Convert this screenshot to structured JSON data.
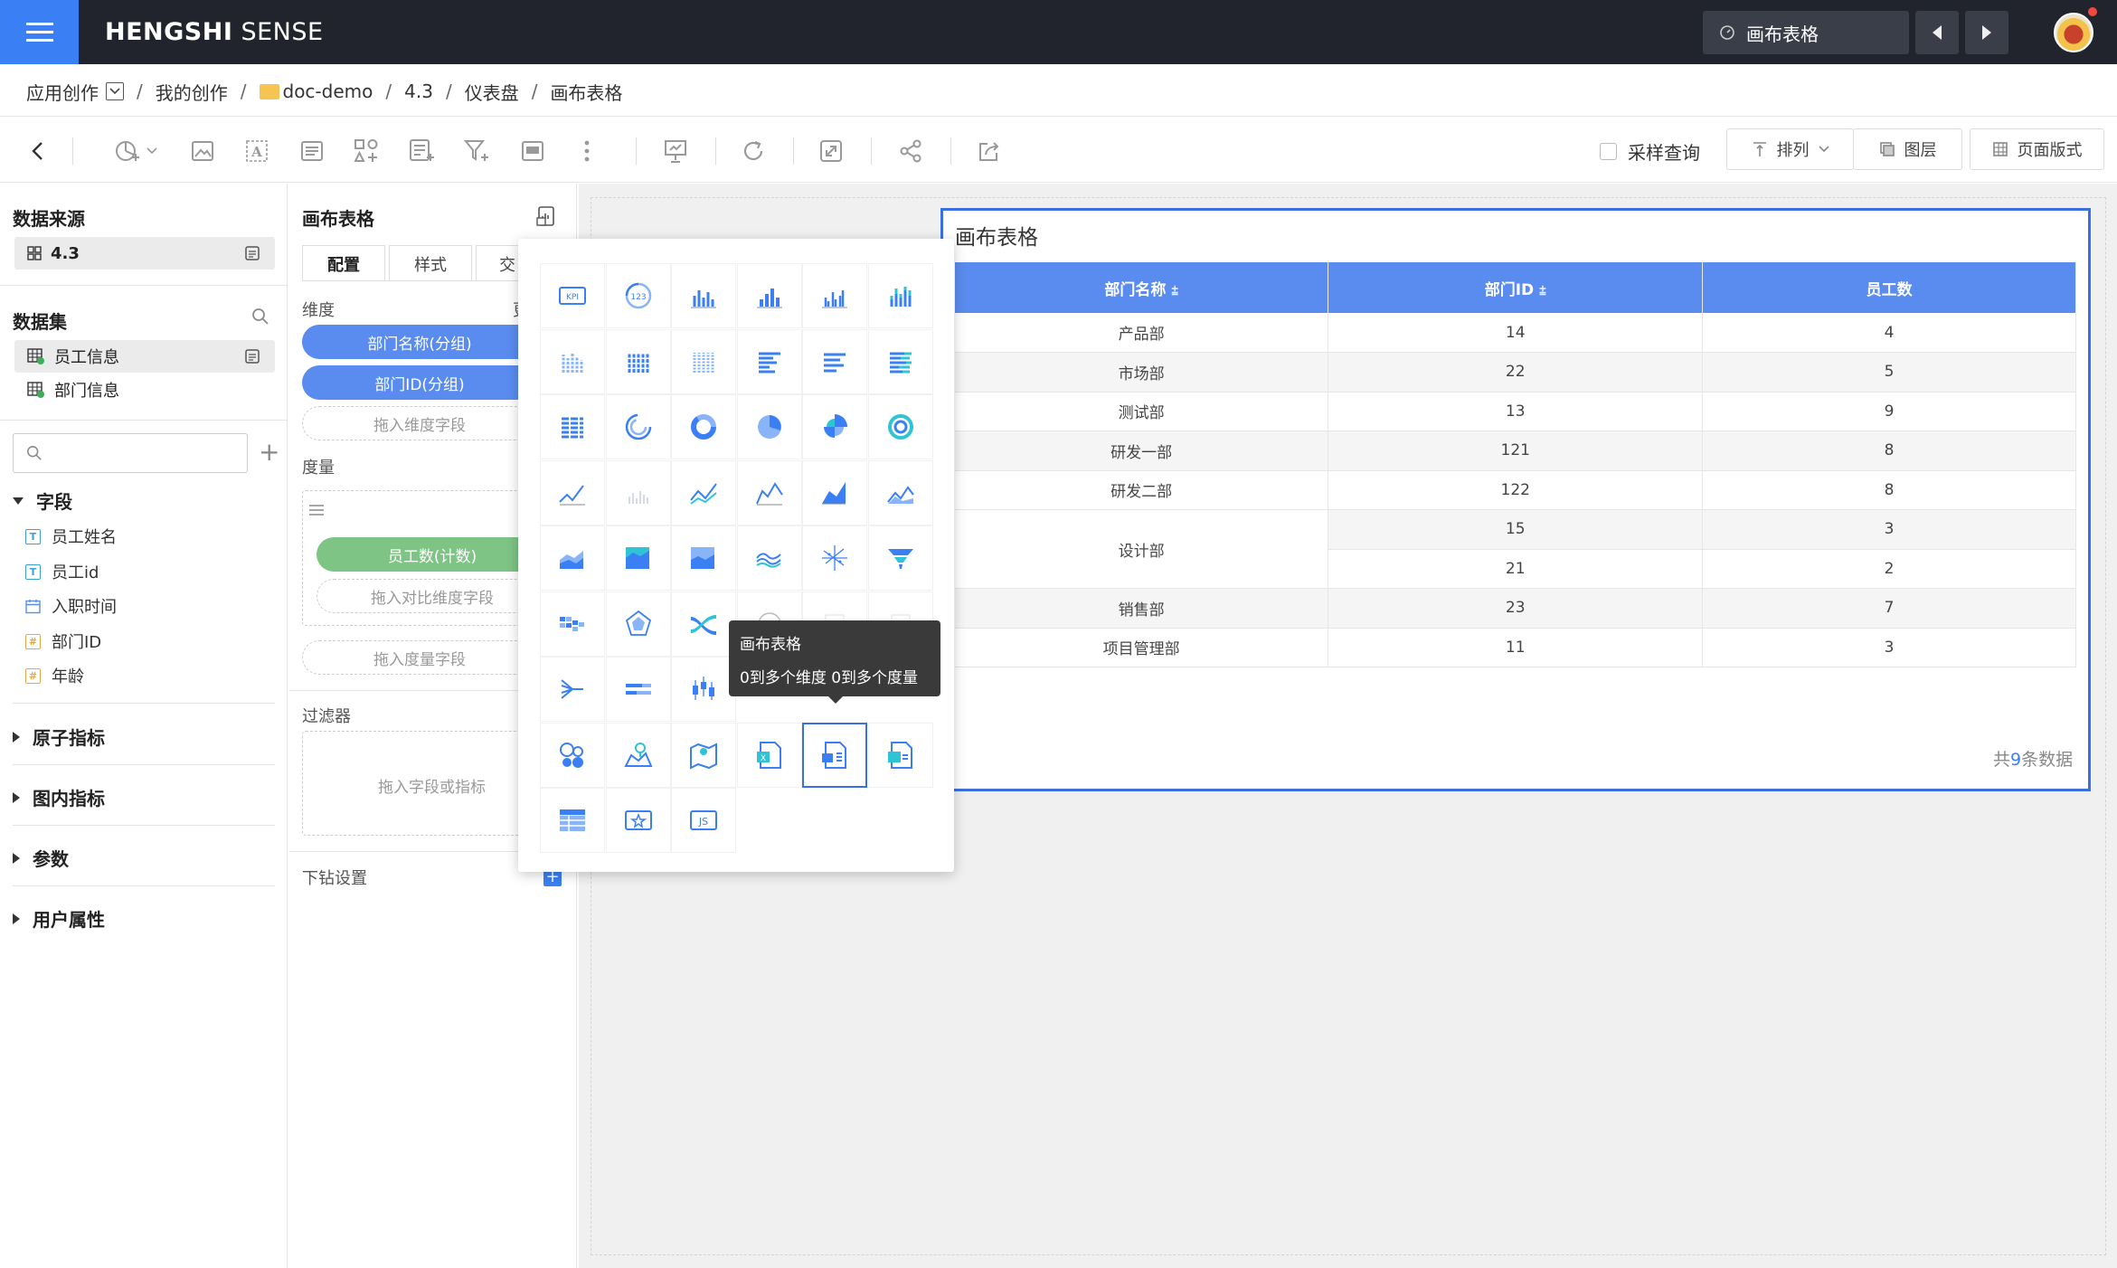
{
  "app": {
    "brand_bold": "HENGSHI",
    "brand_light": " SENSE",
    "current_page": "画布表格"
  },
  "breadcrumb": [
    "应用创作",
    "我的创作",
    "doc-demo",
    "4.3",
    "仪表盘",
    "画布表格"
  ],
  "toolbar": {
    "sample_label": "采样查询",
    "sort_label": "排列",
    "layer_label": "图层",
    "layout_label": "页面版式"
  },
  "left": {
    "datasource_title": "数据来源",
    "datasource_item": "4.3",
    "dataset_title": "数据集",
    "datasets": [
      "员工信息",
      "部门信息"
    ],
    "fields_title": "字段",
    "fields": [
      {
        "label": "员工姓名",
        "type": "T"
      },
      {
        "label": "员工id",
        "type": "T"
      },
      {
        "label": "入职时间",
        "type": "D"
      },
      {
        "label": "部门ID",
        "type": "#"
      },
      {
        "label": "年龄",
        "type": "#"
      }
    ],
    "groups": [
      "原子指标",
      "图内指标",
      "参数",
      "用户属性"
    ]
  },
  "config": {
    "title": "画布表格",
    "tabs": [
      "配置",
      "样式",
      "交"
    ],
    "dimension_label": "维度",
    "dimension_right": "更",
    "dimensions": [
      "部门名称(分组)",
      "部门ID(分组)"
    ],
    "dimension_drop": "拖入维度字段",
    "measure_label": "度量",
    "measure": "员工数(计数)",
    "compare_drop": "拖入对比维度字段",
    "measure_drop": "拖入度量字段",
    "filter_label": "过滤器",
    "filter_drop": "拖入字段或指标",
    "drill_label": "下钻设置"
  },
  "card": {
    "title": "画布表格",
    "headers": [
      "部门名称",
      "部门ID",
      "员工数"
    ],
    "rows": [
      {
        "dept": "产品部",
        "id": "14",
        "count": "4"
      },
      {
        "dept": "市场部",
        "id": "22",
        "count": "5"
      },
      {
        "dept": "测试部",
        "id": "13",
        "count": "9"
      },
      {
        "dept": "研发一部",
        "id": "121",
        "count": "8"
      },
      {
        "dept": "研发二部",
        "id": "122",
        "count": "8"
      },
      {
        "dept": "设计部",
        "id": "15",
        "count": "3"
      },
      {
        "dept": "",
        "id": "21",
        "count": "2"
      },
      {
        "dept": "销售部",
        "id": "23",
        "count": "7"
      },
      {
        "dept": "项目管理部",
        "id": "11",
        "count": "3"
      }
    ],
    "total_prefix": "共",
    "total_count": "9",
    "total_suffix": "条数据"
  },
  "tooltip": {
    "title": "画布表格",
    "desc": "0到多个维度  0到多个度量"
  },
  "picker": {
    "icons": [
      "kpi-icon",
      "gauge-icon",
      "column-icon",
      "grouped-column-icon",
      "multi-column-icon",
      "stacked-column-icon",
      "stacked-column-2-icon",
      "percent-column-icon",
      "grouped-stack-icon",
      "bar-icon",
      "grouped-bar-icon",
      "stacked-bar-icon",
      "percent-bar-icon",
      "radial-bar-icon",
      "donut-icon",
      "pie-icon",
      "rose-icon",
      "ring-icon",
      "line-icon",
      "sparkline-icon",
      "multi-line-icon",
      "area-line-icon",
      "area-icon",
      "mountain-icon",
      "stacked-area-icon",
      "percent-area-icon",
      "band-area-icon",
      "stream-icon",
      "scatter-icon",
      "funnel-icon",
      "heatmap-icon",
      "radar-icon",
      "sankey-icon",
      "pie-outline-icon",
      "blank-icon",
      "blank-icon",
      "tree-icon",
      "bullet-icon",
      "candlestick-icon",
      "",
      "",
      "",
      "bubble-icon",
      "map-pin-icon",
      "region-map-icon",
      "excel-table-icon",
      "canvas-table-icon",
      "pivot-excel-icon",
      "table-grid-icon",
      "image-card-icon",
      "js-chart-icon"
    ],
    "selected_index": 46
  },
  "colors": {
    "accent": "#3b7ff5",
    "table_header": "#5a8cf0",
    "dim_pill": "#5a8cf0",
    "measure_pill": "#7ec484",
    "topbar": "#21242c"
  }
}
